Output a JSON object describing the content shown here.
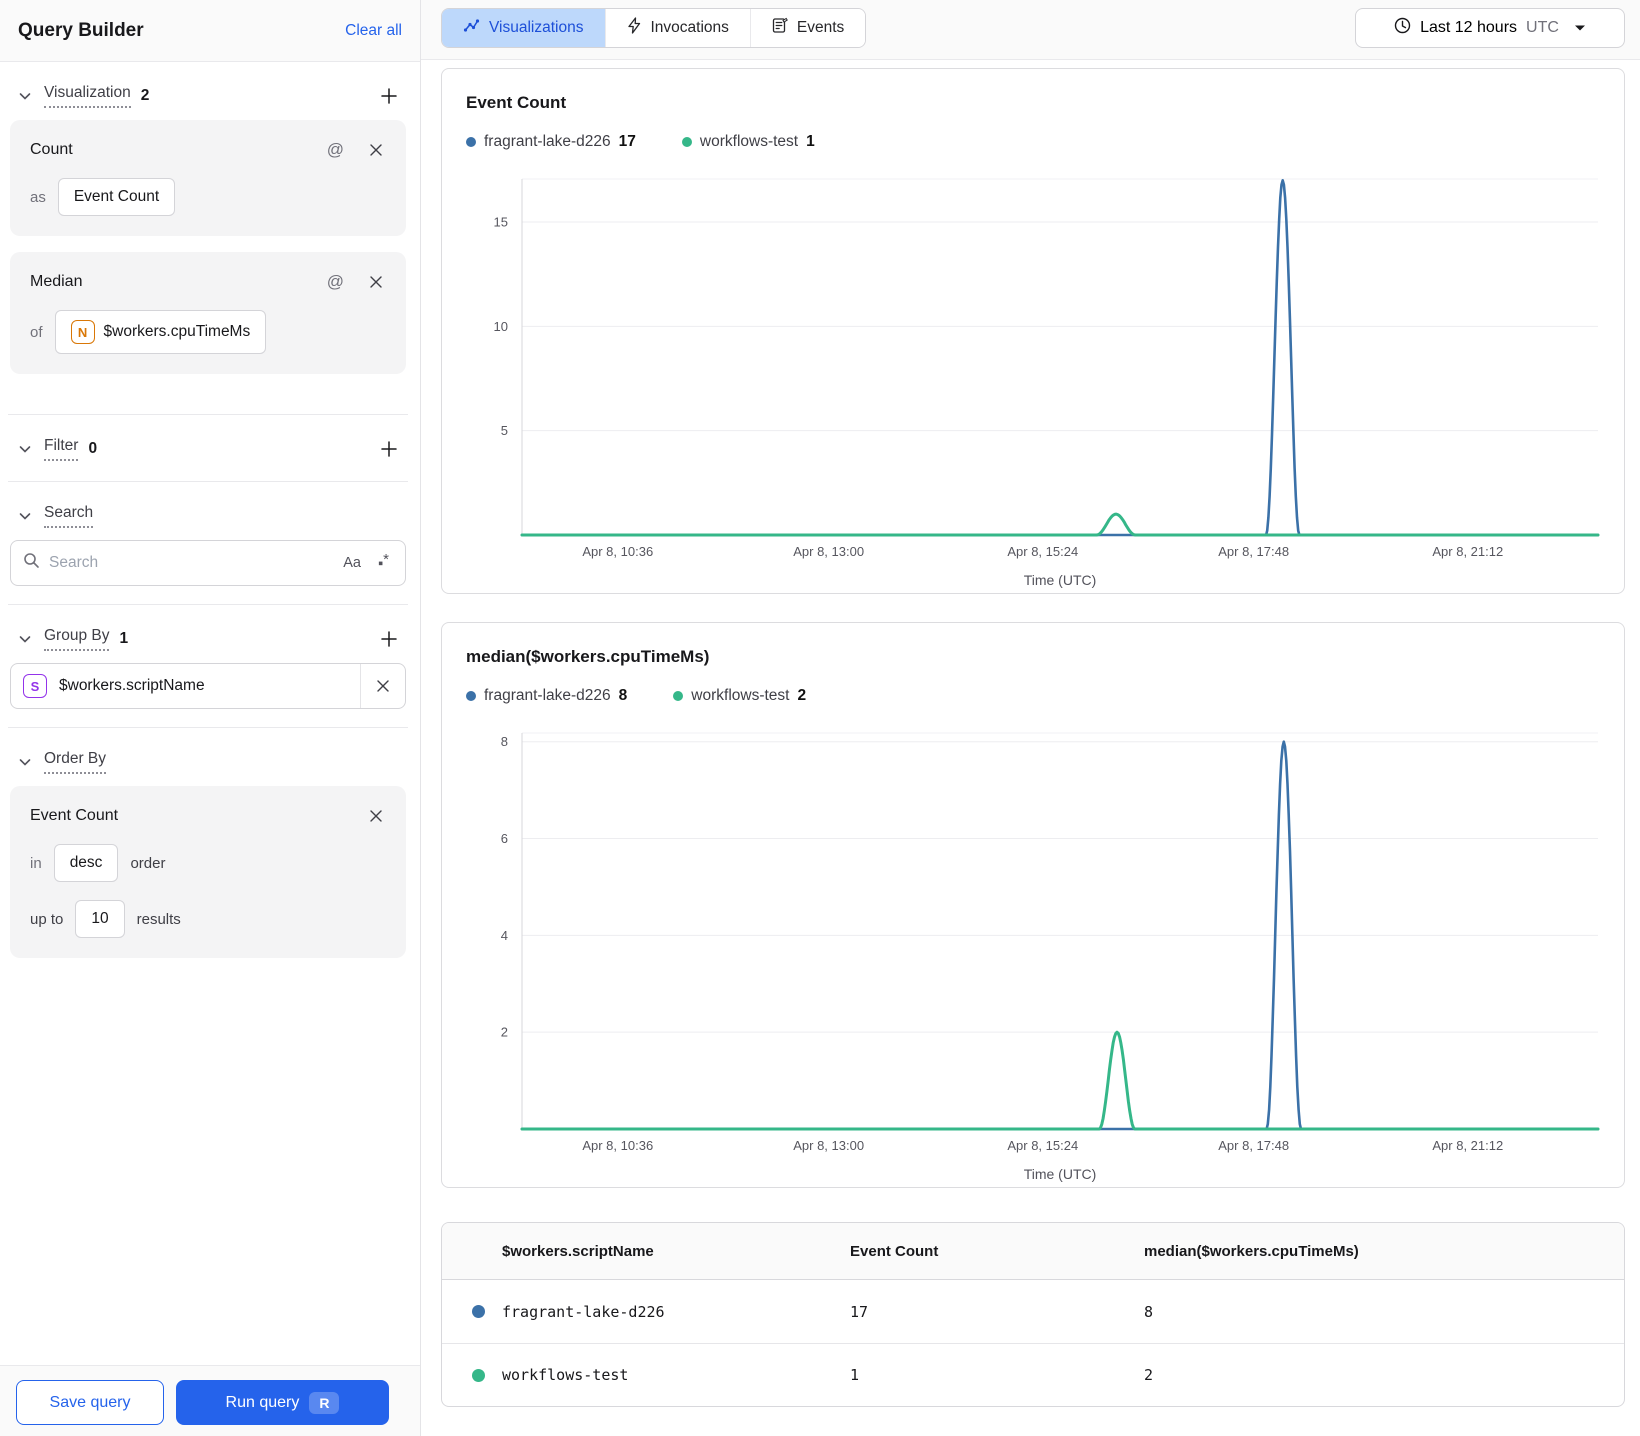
{
  "colors": {
    "blue": "#3b71a8",
    "green": "#35b789",
    "accent": "#2563eb",
    "tab_selected_bg": "#bdd8fb"
  },
  "sidebar": {
    "title": "Query Builder",
    "clear_all": "Clear all",
    "visualization": {
      "label": "Visualization",
      "count": "2"
    },
    "viz_cards": [
      {
        "title": "Count",
        "prefix": "as",
        "value": "Event Count"
      },
      {
        "title": "Median",
        "prefix": "of",
        "chip": "N",
        "value": "$workers.cpuTimeMs"
      }
    ],
    "at_icon": "@",
    "filter": {
      "label": "Filter",
      "count": "0"
    },
    "search": {
      "label": "Search",
      "placeholder": "Search",
      "case_toggle": "Aa",
      "regex_square": "▪",
      "regex_star": "*"
    },
    "group_by": {
      "label": "Group By",
      "count": "1",
      "chip": "S",
      "value": "$workers.scriptName"
    },
    "order_by": {
      "label": "Order By",
      "field": "Event Count",
      "in_label": "in",
      "direction": "desc",
      "order_label": "order",
      "up_to_label": "up to",
      "limit": "10",
      "results_label": "results"
    },
    "save_button": "Save query",
    "run_button": "Run query",
    "run_shortcut": "R"
  },
  "topbar": {
    "tabs": [
      {
        "label": "Visualizations",
        "selected": true
      },
      {
        "label": "Invocations",
        "selected": false
      },
      {
        "label": "Events",
        "selected": false
      }
    ],
    "time_range": {
      "label": "Last 12 hours",
      "timezone": "UTC"
    }
  },
  "charts": [
    {
      "title": "Event Count",
      "legend": [
        {
          "name": "fragrant-lake-d226",
          "value": "17",
          "color": "#3b71a8"
        },
        {
          "name": "workflows-test",
          "value": "1",
          "color": "#35b789"
        }
      ],
      "chart_data": {
        "type": "line",
        "title": "Event Count",
        "xlabel": "Time (UTC)",
        "x_ticks": [
          "Apr 8, 10:36",
          "Apr 8, 13:00",
          "Apr 8, 15:24",
          "Apr 8, 17:48",
          "Apr 8, 21:12"
        ],
        "x_tick_fracs": [
          0.089,
          0.285,
          0.484,
          0.68,
          0.879
        ],
        "y_ticks": [
          5,
          10,
          15
        ],
        "ymax": 17.06,
        "grid": true,
        "series": [
          {
            "name": "fragrant-lake-d226",
            "color": "#3b71a8",
            "width": 2.6,
            "baseline": 0,
            "spikes": [
              {
                "x_frac": 0.707,
                "half_width_frac": 0.0155,
                "peak": 17,
                "peak_time": "Apr 8, ~17:48"
              }
            ]
          },
          {
            "name": "workflows-test",
            "color": "#35b789",
            "width": 3,
            "baseline": 0,
            "spikes": [
              {
                "x_frac": 0.552,
                "half_width_frac": 0.018,
                "peak": 1,
                "peak_time": "Apr 8, ~15:45"
              }
            ]
          }
        ]
      }
    },
    {
      "title": "median($workers.cpuTimeMs)",
      "legend": [
        {
          "name": "fragrant-lake-d226",
          "value": "8",
          "color": "#3b71a8"
        },
        {
          "name": "workflows-test",
          "value": "2",
          "color": "#35b789"
        }
      ],
      "chart_data": {
        "type": "line",
        "title": "median($workers.cpuTimeMs)",
        "xlabel": "Time (UTC)",
        "x_ticks": [
          "Apr 8, 10:36",
          "Apr 8, 13:00",
          "Apr 8, 15:24",
          "Apr 8, 17:48",
          "Apr 8, 21:12"
        ],
        "x_tick_fracs": [
          0.089,
          0.285,
          0.484,
          0.68,
          0.879
        ],
        "y_ticks": [
          2,
          4,
          6,
          8
        ],
        "ymax": 8.18,
        "grid": true,
        "series": [
          {
            "name": "fragrant-lake-d226",
            "color": "#3b71a8",
            "width": 2.6,
            "baseline": 0,
            "spikes": [
              {
                "x_frac": 0.708,
                "half_width_frac": 0.016,
                "peak": 8,
                "peak_time": "Apr 8, ~17:48"
              }
            ]
          },
          {
            "name": "workflows-test",
            "color": "#35b789",
            "width": 3,
            "baseline": 0,
            "spikes": [
              {
                "x_frac": 0.553,
                "half_width_frac": 0.0165,
                "peak": 2,
                "peak_time": "Apr 8, ~15:45"
              }
            ]
          }
        ]
      }
    }
  ],
  "table": {
    "headers": [
      "$workers.scriptName",
      "Event Count",
      "median($workers.cpuTimeMs)"
    ],
    "rows": [
      {
        "color": "#3b71a8",
        "name": "fragrant-lake-d226",
        "event_count": "17",
        "median": "8"
      },
      {
        "color": "#35b789",
        "name": "workflows-test",
        "event_count": "1",
        "median": "2"
      }
    ]
  }
}
